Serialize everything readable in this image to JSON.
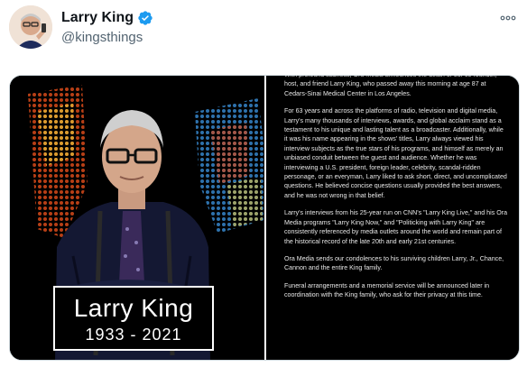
{
  "tweet": {
    "display_name": "Larry King",
    "handle": "@kingsthings",
    "verified": true,
    "avatar_icon": "avatar-photo",
    "more_icon": "more-options-icon"
  },
  "media": {
    "card": {
      "name": "Larry King",
      "years": "1933 - 2021"
    },
    "statement": [
      "With profound sadness, Ora Media announces the death of our co-founder, host, and friend Larry King, who passed away this morning at age 87 at Cedars-Sinai Medical Center in Los Angeles.",
      "For 63 years and across the platforms of radio, television and digital media, Larry's many thousands of interviews, awards, and global acclaim stand as a testament to his unique and lasting talent as a broadcaster. Additionally, while it was his name appearing in the shows' titles, Larry always viewed his interview subjects as the true stars of his programs, and himself as merely an unbiased conduit between the guest and audience. Whether he was interviewing a U.S. president, foreign leader, celebrity, scandal-ridden personage, or an everyman, Larry liked to ask short, direct, and uncomplicated questions. He believed concise questions usually provided the best answers, and he was not wrong in that belief.",
      "Larry's interviews from his 25-year run on CNN's \"Larry King Live,\" and his Ora Media programs \"Larry King Now,\" and \"Politicking with Larry King\" are consistently referenced by media outlets around the world and remain part of the historical record of the late 20th and early 21st centuries.",
      "Ora Media sends our condolences to his surviving children Larry, Jr., Chance, Cannon and the entire King family.",
      "Funeral arrangements and a memorial service will be announced later in coordination with the King family, who ask for their privacy at this time."
    ]
  },
  "colors": {
    "verified_blue": "#1d9bf0",
    "handle_gray": "#536471",
    "media_bg": "#000000"
  }
}
